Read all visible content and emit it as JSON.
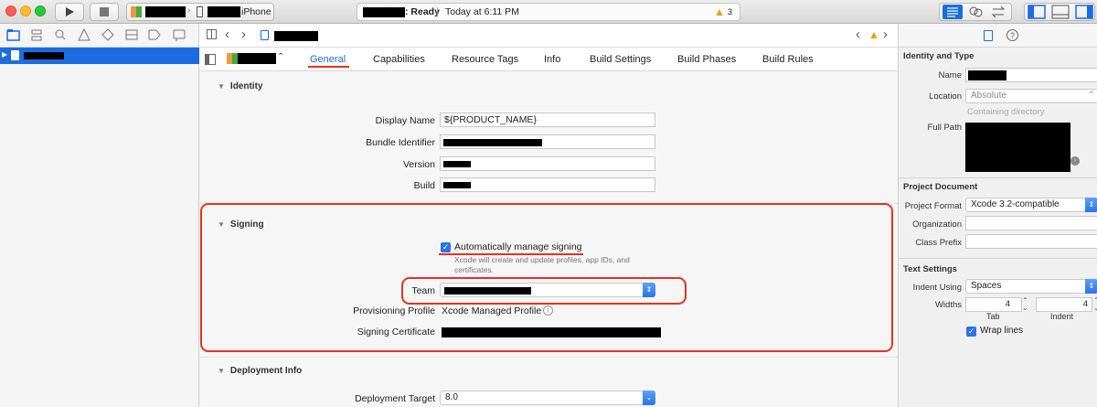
{
  "toolbar": {
    "device": "iPhone",
    "status_ready": "Ready",
    "status_time": "Today at 6:11 PM",
    "warning_count": "3"
  },
  "tabs": {
    "general": "General",
    "capabilities": "Capabilities",
    "resource_tags": "Resource Tags",
    "info": "Info",
    "build_settings": "Build Settings",
    "build_phases": "Build Phases",
    "build_rules": "Build Rules"
  },
  "identity": {
    "section_title": "Identity",
    "display_name_label": "Display Name",
    "display_name_value": "${PRODUCT_NAME}",
    "bundle_id_label": "Bundle Identifier",
    "version_label": "Version",
    "build_label": "Build"
  },
  "signing": {
    "section_title": "Signing",
    "auto_manage_label": "Automatically manage signing",
    "auto_manage_desc_1": "Xcode will create and update profiles, app IDs, and",
    "auto_manage_desc_2": "certificates.",
    "team_label": "Team",
    "prov_profile_label": "Provisioning Profile",
    "prov_profile_value": "Xcode Managed Profile",
    "signing_cert_label": "Signing Certificate"
  },
  "deployment": {
    "section_title": "Deployment Info",
    "target_label": "Deployment Target",
    "target_value": "8.0"
  },
  "inspector": {
    "identity_type_title": "Identity and Type",
    "name_label": "Name",
    "location_label": "Location",
    "location_value": "Absolute",
    "containing_dir": "Containing directory",
    "full_path_label": "Full Path",
    "project_doc_title": "Project Document",
    "project_format_label": "Project Format",
    "project_format_value": "Xcode 3.2-compatible",
    "organization_label": "Organization",
    "class_prefix_label": "Class Prefix",
    "text_settings_title": "Text Settings",
    "indent_using_label": "Indent Using",
    "indent_using_value": "Spaces",
    "widths_label": "Widths",
    "tab_width": "4",
    "indent_width": "4",
    "tab_caption": "Tab",
    "indent_caption": "Indent",
    "wrap_lines_label": "Wrap lines"
  },
  "colors": {
    "accent": "#2c73e4",
    "annotation_red": "#e8321e",
    "selection": "#1b6ce0"
  }
}
